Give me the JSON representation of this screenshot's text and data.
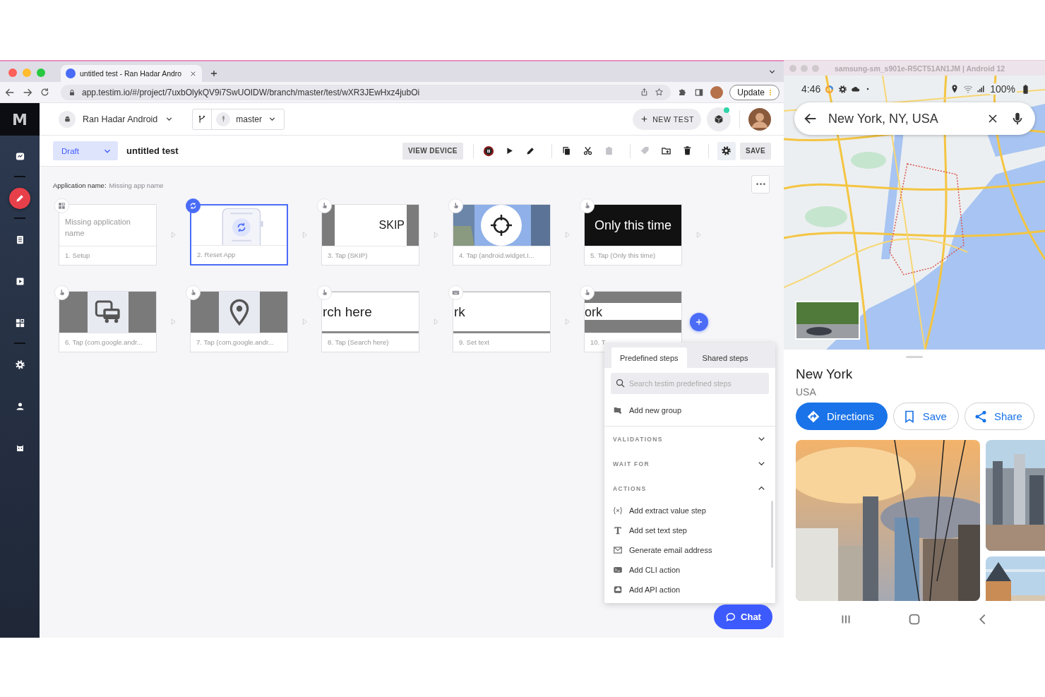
{
  "browser": {
    "tab_title": "untitled test - Ran Hadar Andro",
    "url": "app.testim.io/#/project/7uxbOlykQV9i7SwUOIDW/branch/master/test/wXR3JEwHxz4jubOi",
    "update": "Update"
  },
  "sidebar": {
    "logo": "M",
    "items": [
      {
        "kind": "dashboard",
        "selected": false,
        "divider_after": true
      },
      {
        "kind": "editor",
        "selected": true,
        "divider_after": true
      },
      {
        "kind": "tests",
        "selected": false,
        "divider_after": false
      },
      {
        "kind": "runs",
        "selected": false,
        "divider_after": false
      },
      {
        "kind": "components",
        "selected": false,
        "divider_after": true
      },
      {
        "kind": "settings",
        "selected": false,
        "divider_after": false
      },
      {
        "kind": "account",
        "selected": false,
        "divider_after": false
      },
      {
        "kind": "bot",
        "selected": false,
        "divider_after": false
      }
    ]
  },
  "header": {
    "project": "Ran Hadar Android",
    "branch": "master",
    "new_test": "NEW TEST"
  },
  "toolbar": {
    "status": "Draft",
    "test_name": "untitled test",
    "view_device": "VIEW DEVICE",
    "save": "SAVE",
    "tools": [
      {
        "kind": "record",
        "disabled": false,
        "divider_before": true
      },
      {
        "kind": "play",
        "disabled": false,
        "divider_before": false
      },
      {
        "kind": "pen",
        "disabled": false,
        "divider_before": false
      },
      {
        "kind": "copy",
        "disabled": false,
        "divider_before": true
      },
      {
        "kind": "cut",
        "disabled": false,
        "divider_before": false
      },
      {
        "kind": "paste",
        "disabled": true,
        "divider_before": false
      },
      {
        "kind": "tag",
        "disabled": true,
        "divider_before": true
      },
      {
        "kind": "folder",
        "disabled": false,
        "divider_before": false
      },
      {
        "kind": "delete",
        "disabled": false,
        "divider_before": false
      },
      {
        "kind": "settings",
        "disabled": false,
        "divider_before": true
      }
    ]
  },
  "app_name": {
    "label": "Application name:",
    "value": "Missing app name"
  },
  "steps": [
    {
      "kind": "setup",
      "label": "1. Setup",
      "selected": false,
      "preview": {
        "kind": "note",
        "text": "Missing application name"
      }
    },
    {
      "kind": "reset",
      "label": "2. Reset App",
      "selected": true,
      "preview": {
        "kind": "reset"
      }
    },
    {
      "kind": "tap",
      "label": "3. Tap (SKIP)",
      "selected": false,
      "preview": {
        "kind": "button",
        "text": "SKIP"
      }
    },
    {
      "kind": "tap",
      "label": "4. Tap (android.widget.I...",
      "selected": false,
      "preview": {
        "kind": "map"
      }
    },
    {
      "kind": "tap",
      "label": "5. Tap (Only this time)",
      "selected": false,
      "preview": {
        "kind": "dark",
        "text": "Only this time"
      }
    },
    {
      "kind": "tap",
      "label": "6. Tap (com.google.andr...",
      "selected": false,
      "preview": {
        "kind": "cars"
      }
    },
    {
      "kind": "tap",
      "label": "7. Tap (com.google.andr...",
      "selected": false,
      "preview": {
        "kind": "pin"
      }
    },
    {
      "kind": "tap",
      "label": "8. Tap (Search here)",
      "selected": false,
      "preview": {
        "kind": "field",
        "text": "rch here"
      }
    },
    {
      "kind": "keyboard",
      "label": "9. Set text",
      "selected": false,
      "preview": {
        "kind": "field",
        "text": "rk"
      }
    },
    {
      "kind": "tap",
      "label": "10. T",
      "selected": false,
      "preview": {
        "kind": "banner",
        "text": "ork"
      }
    }
  ],
  "panel": {
    "tabs": [
      {
        "label": "Predefined steps",
        "selected": true
      },
      {
        "label": "Shared steps",
        "selected": false
      }
    ],
    "search_placeholder": "Search testim predefined steps",
    "add_group": "Add new group",
    "sections": [
      {
        "title": "VALIDATIONS",
        "expanded": false
      },
      {
        "title": "WAIT FOR",
        "expanded": false
      },
      {
        "title": "ACTIONS",
        "expanded": true,
        "items": [
          {
            "kind": "variable",
            "label": "Add extract value step"
          },
          {
            "kind": "text",
            "label": "Add set text step"
          },
          {
            "kind": "mail",
            "label": "Generate email address"
          },
          {
            "kind": "terminal",
            "label": "Add CLI action"
          },
          {
            "kind": "api",
            "label": "Add API action"
          }
        ]
      }
    ]
  },
  "chat": "Chat",
  "device": {
    "title": "samsung-sm_s901e-R5CT51AN1JM | Android 12",
    "time": "4:46",
    "battery": "100%",
    "search": "New York, NY, USA",
    "place": "New York",
    "region": "USA",
    "actions": [
      {
        "kind": "directions",
        "label": "Directions",
        "primary": true
      },
      {
        "kind": "save",
        "label": "Save",
        "primary": false
      },
      {
        "kind": "share",
        "label": "Share",
        "primary": false
      }
    ]
  }
}
